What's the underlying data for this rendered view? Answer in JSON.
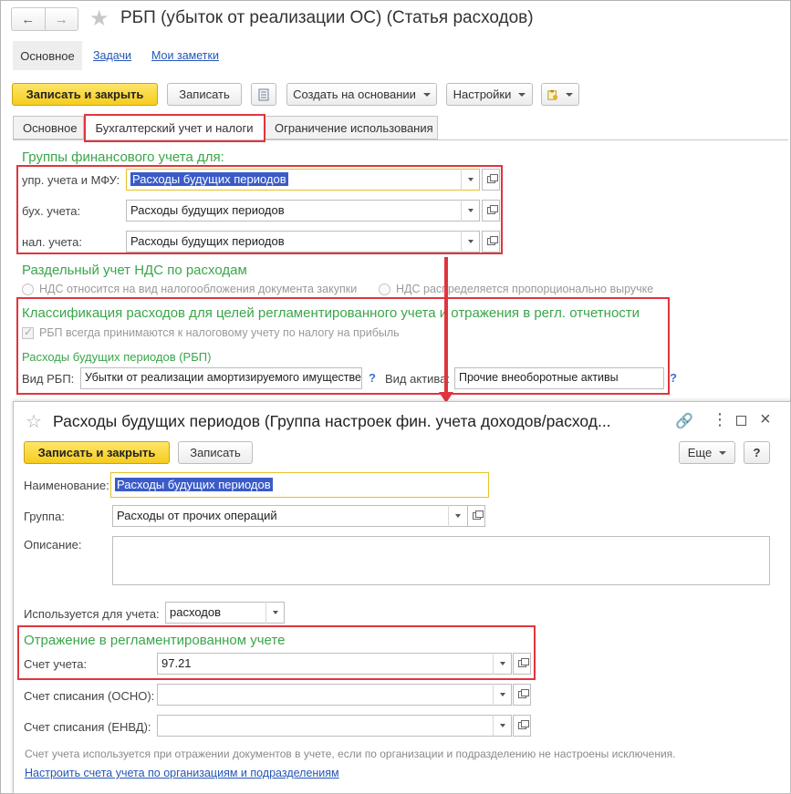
{
  "window": {
    "title": "РБП (убыток от реализации ОС) (Статья расходов)",
    "tabs_top": [
      "Основное",
      "Задачи",
      "Мои заметки"
    ],
    "toolbar": {
      "save_close": "Записать и закрыть",
      "save": "Записать",
      "create_based": "Создать на основании",
      "settings": "Настройки"
    },
    "tabs": [
      "Основное",
      "Бухгалтерский учет и налоги",
      "Ограничение использования"
    ],
    "groups_title": "Группы финансового учета для:",
    "rows": [
      {
        "label": "упр. учета и МФУ:",
        "value": "Расходы будущих периодов"
      },
      {
        "label": "бух. учета:",
        "value": "Расходы будущих периодов"
      },
      {
        "label": "нал. учета:",
        "value": "Расходы будущих периодов"
      }
    ],
    "vat_title": "Раздельный учет НДС по расходам",
    "vat_opt1": "НДС относится на вид налогообложения документа закупки",
    "vat_opt2": "НДС распределяется пропорционально выручке",
    "class_title": "Классификация расходов для целей регламентированного учета и отражения в регл. отчетности",
    "rbp_check": "РБП всегда принимаются к налоговому учету по налогу на прибыль",
    "rbp_title": "Расходы будущих периодов (РБП)",
    "vid_rbp_label": "Вид РБП:",
    "vid_rbp_value": "Убытки от реализации амортизируемого имуществе",
    "vid_aktiva_label": "Вид актива:",
    "vid_aktiva_value": "Прочие внеоборотные активы",
    "help": "?"
  },
  "dialog": {
    "title": "Расходы будущих периодов (Группа настроек фин. учета доходов/расход...",
    "save_close": "Записать и закрыть",
    "save": "Записать",
    "more": "Еще",
    "help": "?",
    "name_label": "Наименование:",
    "name_value": "Расходы будущих периодов",
    "group_label": "Группа:",
    "group_value": "Расходы от прочих операций",
    "desc_label": "Описание:",
    "used_label": "Используется для учета:",
    "used_value": "расходов",
    "reg_title": "Отражение в регламентированном учете",
    "account_label": "Счет учета:",
    "account_value": "97.21",
    "writeoff_osno_label": "Счет списания (ОСНО):",
    "writeoff_envd_label": "Счет списания (ЕНВД):",
    "note": "Счет учета используется при отражении документов в учете, если по организации и подразделению не настроены исключения.",
    "link": "Настроить счета учета по организациям и подразделениям"
  },
  "colors": {
    "accent_green": "#3aa64a",
    "highlight_red": "#e0353d",
    "button_yellow": "#f5cc1d",
    "selection_blue": "#3a5bc8"
  }
}
